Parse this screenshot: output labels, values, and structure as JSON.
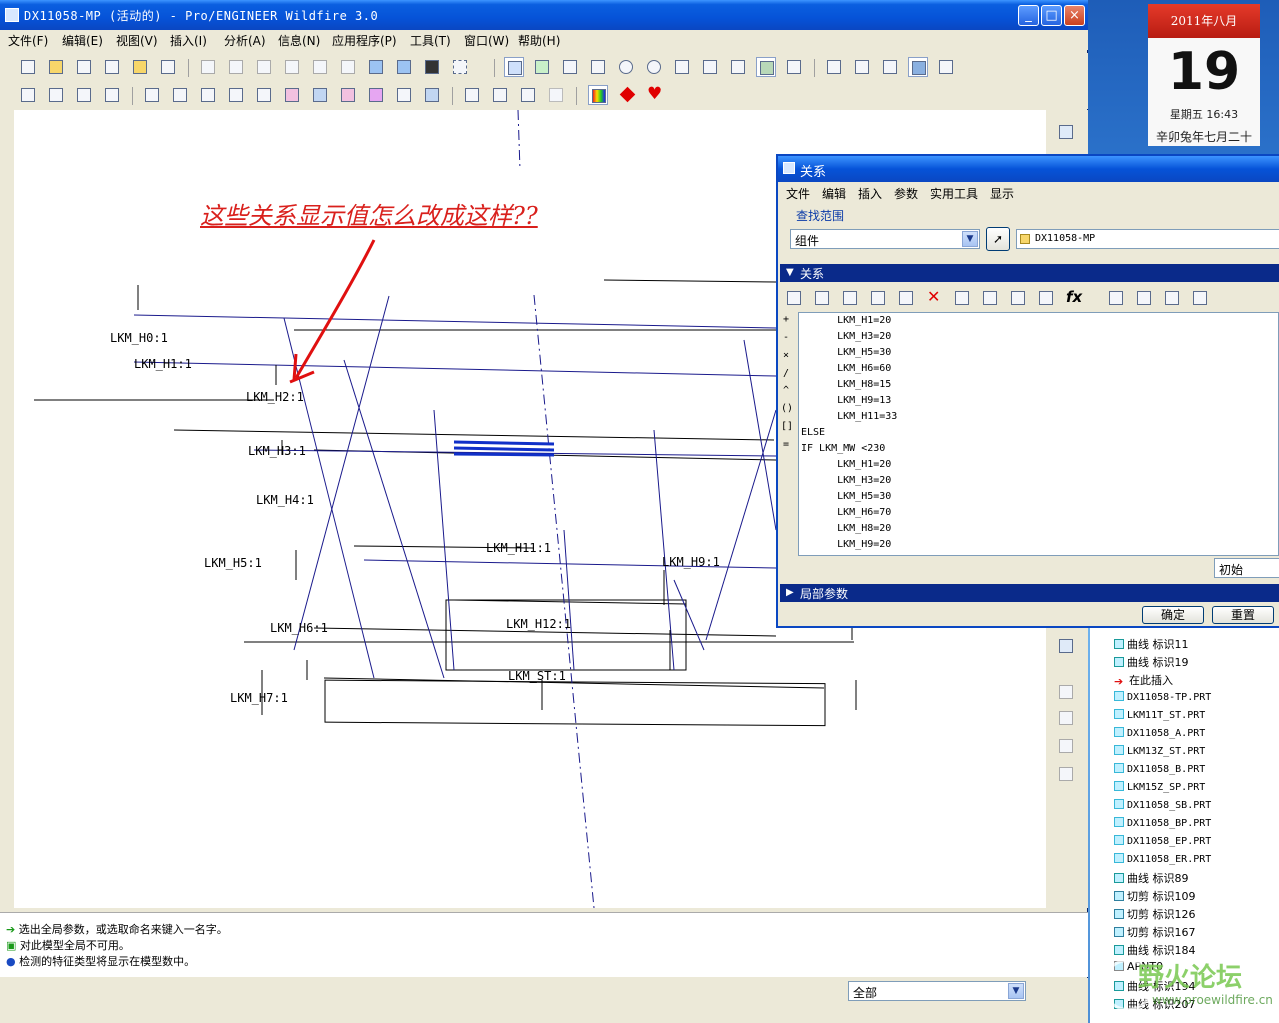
{
  "window": {
    "title": "DX11058-MP (活动的) - Pro/ENGINEER Wildfire 3.0",
    "minimize": "_",
    "maximize": "□",
    "close": "×"
  },
  "menu": [
    "文件(F)",
    "编辑(E)",
    "视图(V)",
    "插入(I)",
    "分析(A)",
    "信息(N)",
    "应用程序(P)",
    "工具(T)",
    "窗口(W)",
    "帮助(H)"
  ],
  "annotation": "这些关系显示值怎么改成这样??",
  "dimensions": [
    "LKM_H0:1",
    "LKM_H1:1",
    "LKM_H2:1",
    "LKM_H3:1",
    "LKM_H4:1",
    "LKM_H5:1",
    "LKM_H6:1",
    "LKM_H7:1",
    "LKM_H11:1",
    "LKM_H12:1",
    "LKM_H9:1",
    "LKM_ST:1"
  ],
  "messages": [
    "选出全局参数，或选取命名来键入一名字。",
    "对此模型全局不可用。",
    "检测的特征类型将显示在模型数中。"
  ],
  "status": {
    "filter": "全部"
  },
  "dialog": {
    "title": "关系",
    "menu": [
      "文件",
      "编辑",
      "插入",
      "参数",
      "实用工具",
      "显示"
    ],
    "lookin_label": "查找范围",
    "lookin_value": "组件",
    "model_value": "DX11058-MP",
    "section_relations": "关系",
    "section_local": "局部参数",
    "operators": [
      "+",
      "-",
      "×",
      "/",
      "^",
      "()",
      "[]",
      "="
    ],
    "lines": [
      "      LKM_H1=20",
      "      LKM_H3=20",
      "      LKM_H5=30",
      "      LKM_H6=60",
      "      LKM_H8=15",
      "      LKM_H9=13",
      "      LKM_H11=33",
      "ELSE",
      "IF LKM_MW <230",
      "      LKM_H1=20",
      "      LKM_H3=20",
      "      LKM_H5=30",
      "      LKM_H6=70",
      "      LKM_H8=20",
      "      LKM_H9=20"
    ],
    "initial_value": "初始",
    "ok": "确定",
    "reset": "重置"
  },
  "tree": [
    {
      "label": "曲线 标识11",
      "type": "curve"
    },
    {
      "label": "曲线 标识19",
      "type": "curve"
    },
    {
      "label": "在此插入",
      "type": "insert"
    },
    {
      "label": "DX11058-TP.PRT",
      "type": "part"
    },
    {
      "label": "LKM11T_ST.PRT",
      "type": "part"
    },
    {
      "label": "DX11058_A.PRT",
      "type": "part"
    },
    {
      "label": "LKM13Z_ST.PRT",
      "type": "part"
    },
    {
      "label": "DX11058_B.PRT",
      "type": "part"
    },
    {
      "label": "LKM15Z_SP.PRT",
      "type": "part"
    },
    {
      "label": "DX11058_SB.PRT",
      "type": "part"
    },
    {
      "label": "DX11058_BP.PRT",
      "type": "part"
    },
    {
      "label": "DX11058_EP.PRT",
      "type": "part"
    },
    {
      "label": "DX11058_ER.PRT",
      "type": "part"
    },
    {
      "label": "曲线 标识89",
      "type": "curve"
    },
    {
      "label": "切剪 标识109",
      "type": "cut"
    },
    {
      "label": "切剪 标识126",
      "type": "cut"
    },
    {
      "label": "切剪 标识167",
      "type": "cut"
    },
    {
      "label": "曲线 标识184",
      "type": "curve"
    },
    {
      "label": "APNT0",
      "type": "point"
    },
    {
      "label": "曲线 标识194",
      "type": "curve"
    },
    {
      "label": "曲线 标识207",
      "type": "curve"
    }
  ],
  "calendar": {
    "month": "2011年八月",
    "day": "19",
    "weekday_time": "星期五 16:43",
    "lunar": "辛卯兔年七月二十"
  },
  "watermark": "野火论坛",
  "watermark_url": "www.proewildfire.cn",
  "colors": {
    "accent": "#0a47c2",
    "annotation": "#d9201c"
  }
}
